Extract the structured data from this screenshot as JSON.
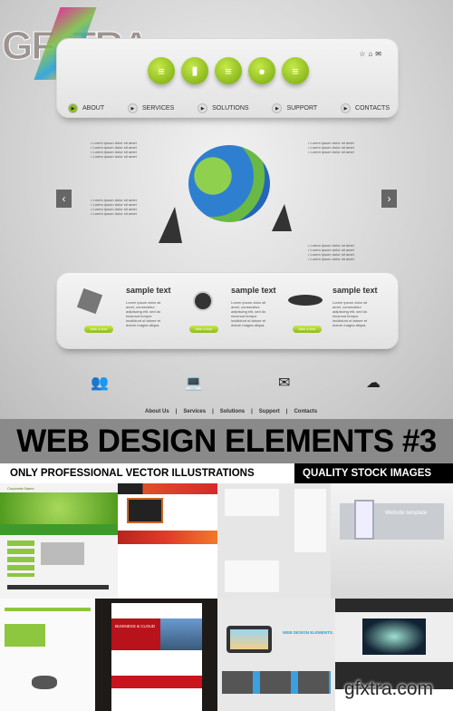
{
  "hero": {
    "logo": "GFXTRA.COM",
    "nav": [
      "ABOUT",
      "SERVICES",
      "SOLUTIONS",
      "SUPPORT",
      "CONTACTS"
    ],
    "header_icons": [
      "star-icon",
      "home-icon",
      "mail-icon"
    ],
    "ball_icons": [
      "text-icon",
      "document-icon",
      "text-icon",
      "chat-icon",
      "text-icon"
    ],
    "features": [
      {
        "title": "sample text",
        "button": "take a tour",
        "icon": "envelope-icon"
      },
      {
        "title": "sample text",
        "button": "take a tour",
        "icon": "stopwatch-icon"
      },
      {
        "title": "sample text",
        "button": "take a tour",
        "icon": "chat-bubbles-icon"
      }
    ],
    "footer_links": [
      "About Us",
      "Services",
      "Solutions",
      "Support",
      "Contacts"
    ],
    "accent": "#8dbb1e"
  },
  "banner": {
    "title": "WEB DESIGN ELEMENTS #3",
    "left_tagline": "ONLY PROFESSIONAL VECTOR ILLUSTRATIONS",
    "right_tagline": "QUALITY STOCK IMAGES"
  },
  "thumbnails": {
    "t1_brand": "Corporate Name",
    "t4_heading": "Website template",
    "t6_heading": "BUSINESS & CLOUD",
    "t7_heading": "WEB DESIGN ELEMENTS.",
    "watermark": "gfxtra.com"
  }
}
